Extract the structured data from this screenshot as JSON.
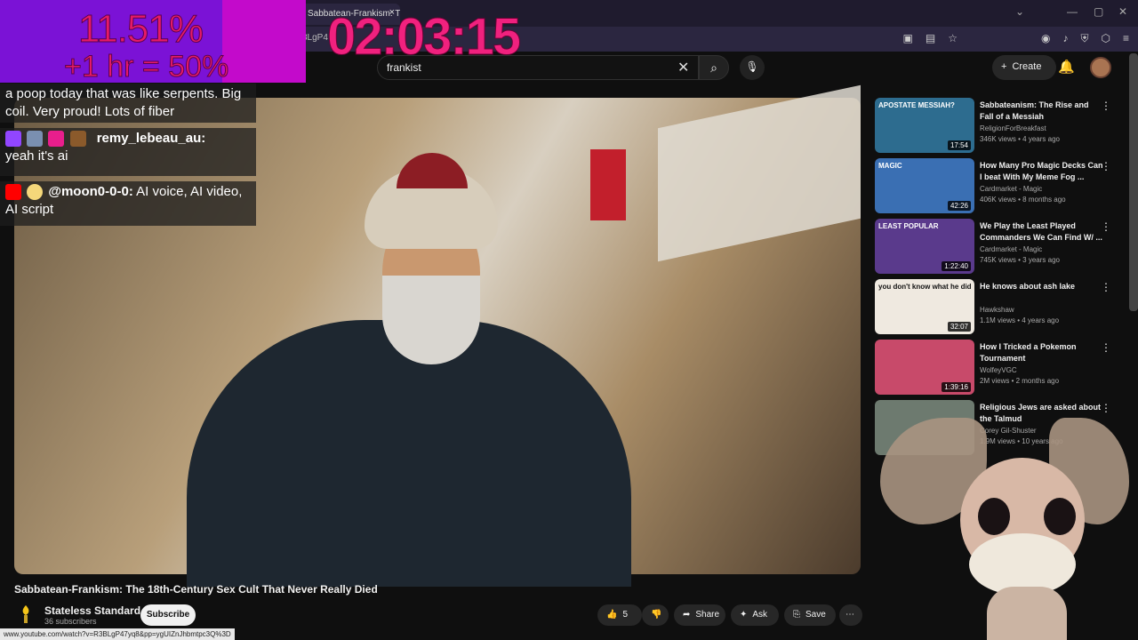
{
  "browser": {
    "tab_title": "Sabbatean-Frankism: The",
    "tab_close": "×",
    "url_fragment": "3LgP4",
    "status_url": "www.youtube.com/watch?v=R3BLgP47yq8&pp=ygUIZnJhbmtpc3Q%3D"
  },
  "overlay": {
    "percent": "11.51%",
    "bonus": "+1 hr = 50%",
    "timer": "02:03:15"
  },
  "header": {
    "search_value": "frankist",
    "create_label": "Create"
  },
  "chat": [
    {
      "user": "",
      "text": "a poop today that was like serpents. Big coil. Very proud! Lots of fiber"
    },
    {
      "user": "remy_lebeau_au:",
      "text": "yeah it's ai"
    },
    {
      "user": "@moon0-0-0:",
      "text": "AI voice, AI video, AI script"
    }
  ],
  "video": {
    "title": "Sabbatean-Frankism: The 18th-Century Sex Cult That Never Really Died",
    "channel": "Stateless Standard",
    "subscribers": "36 subscribers",
    "subscribe_label": "Subscribe",
    "likes": "5",
    "share_label": "Share",
    "ask_label": "Ask",
    "save_label": "Save"
  },
  "recommendations": [
    {
      "title": "Sabbateanism: The Rise and Fall of a Messiah",
      "channel": "ReligionForBreakfast",
      "meta": "346K views • 4 years ago",
      "duration": "17:54",
      "thumb_text": "APOSTATE MESSIAH?",
      "color": "#2d6c8f"
    },
    {
      "title": "How Many Pro Magic Decks Can I beat With My Meme Fog ...",
      "channel": "Cardmarket - Magic",
      "meta": "406K views • 8 months ago",
      "duration": "42:26",
      "thumb_text": "MAGIC",
      "color": "#3a6fb3"
    },
    {
      "title": "We Play the Least Played Commanders We Can Find W/ ...",
      "channel": "Cardmarket - Magic",
      "meta": "745K views • 3 years ago",
      "duration": "1:22:40",
      "thumb_text": "LEAST POPULAR",
      "color": "#5a3a8c"
    },
    {
      "title": "He knows about ash lake",
      "channel": "Hawkshaw",
      "meta": "1.1M views • 4 years ago",
      "duration": "32:07",
      "thumb_text": "you don't know what he did",
      "color": "#efe9e0"
    },
    {
      "title": "How I Tricked a Pokemon Tournament",
      "channel": "WolfeyVGC",
      "meta": "2M views • 2 months ago",
      "duration": "1:39:16",
      "thumb_text": "",
      "color": "#c84a6a"
    },
    {
      "title": "Religious Jews are asked about the Talmud",
      "channel": "Corey Gil-Shuster",
      "meta": "1.9M views • 10 years ago",
      "duration": "",
      "thumb_text": "",
      "color": "#6d7a6f"
    }
  ]
}
